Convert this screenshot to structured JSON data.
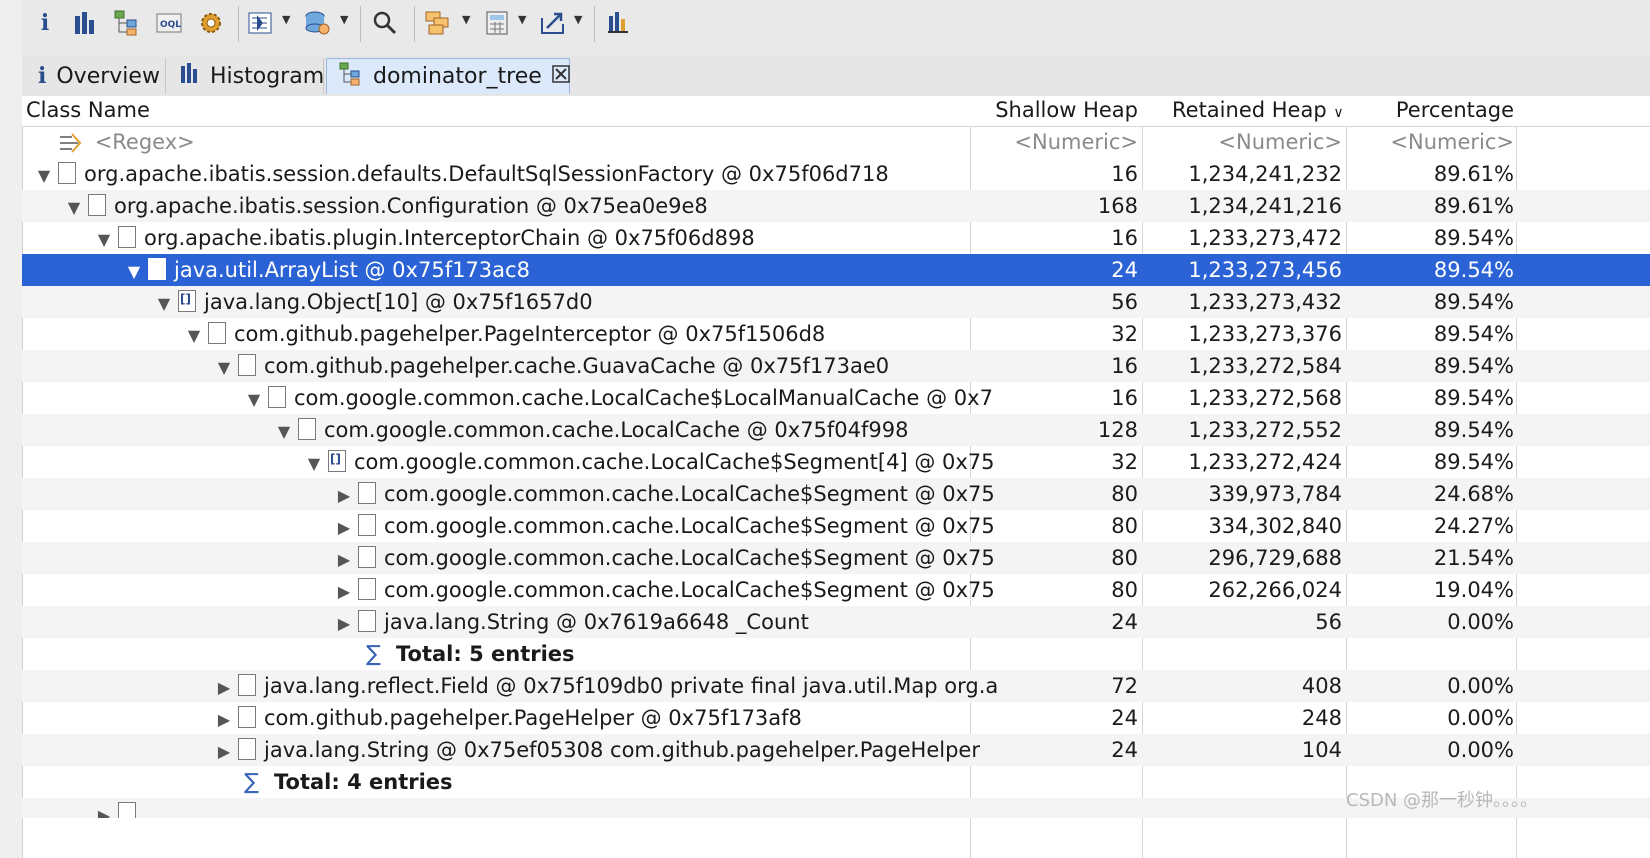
{
  "toolbar": {
    "icons": [
      "info-icon",
      "histogram-icon",
      "dominator-tree-icon",
      "oql-icon",
      "gear-icon",
      "query-browser-icon",
      "heap-dump-icon",
      "search-icon",
      "group-by-icon",
      "calculator-icon",
      "export-icon",
      "leak-suspects-icon"
    ]
  },
  "tabs": [
    {
      "label": "Overview",
      "icon": "i"
    },
    {
      "label": "Histogram",
      "icon": "▮▮"
    },
    {
      "label": "dominator_tree",
      "icon": "⊞"
    }
  ],
  "columns": {
    "name": "Class Name",
    "shallow": "Shallow Heap",
    "retained": "Retained Heap",
    "percentage": "Percentage"
  },
  "filter_row": {
    "name": "<Regex>",
    "shallow": "<Numeric>",
    "retained": "<Numeric>",
    "percentage": "<Numeric>"
  },
  "rows": [
    {
      "name": "org.apache.ibatis.session.defaults.DefaultSqlSessionFactory @ 0x75f06d718",
      "shallow": "16",
      "retained": "1,234,241,232",
      "percentage": "89.61%"
    },
    {
      "name": "org.apache.ibatis.session.Configuration @ 0x75ea0e9e8",
      "shallow": "168",
      "retained": "1,234,241,216",
      "percentage": "89.61%"
    },
    {
      "name": "org.apache.ibatis.plugin.InterceptorChain @ 0x75f06d898",
      "shallow": "16",
      "retained": "1,233,273,472",
      "percentage": "89.54%"
    },
    {
      "name": "java.util.ArrayList @ 0x75f173ac8",
      "shallow": "24",
      "retained": "1,233,273,456",
      "percentage": "89.54%"
    },
    {
      "name": "java.lang.Object[10] @ 0x75f1657d0",
      "shallow": "56",
      "retained": "1,233,273,432",
      "percentage": "89.54%"
    },
    {
      "name": "com.github.pagehelper.PageInterceptor @ 0x75f1506d8",
      "shallow": "32",
      "retained": "1,233,273,376",
      "percentage": "89.54%"
    },
    {
      "name": "com.github.pagehelper.cache.GuavaCache @ 0x75f173ae0",
      "shallow": "16",
      "retained": "1,233,272,584",
      "percentage": "89.54%"
    },
    {
      "name": "com.google.common.cache.LocalCache$LocalManualCache @ 0x7",
      "shallow": "16",
      "retained": "1,233,272,568",
      "percentage": "89.54%"
    },
    {
      "name": "com.google.common.cache.LocalCache @ 0x75f04f998",
      "shallow": "128",
      "retained": "1,233,272,552",
      "percentage": "89.54%"
    },
    {
      "name": "com.google.common.cache.LocalCache$Segment[4] @ 0x75",
      "shallow": "32",
      "retained": "1,233,272,424",
      "percentage": "89.54%"
    },
    {
      "name": "com.google.common.cache.LocalCache$Segment @ 0x75",
      "shallow": "80",
      "retained": "339,973,784",
      "percentage": "24.68%"
    },
    {
      "name": "com.google.common.cache.LocalCache$Segment @ 0x75",
      "shallow": "80",
      "retained": "334,302,840",
      "percentage": "24.27%"
    },
    {
      "name": "com.google.common.cache.LocalCache$Segment @ 0x75",
      "shallow": "80",
      "retained": "296,729,688",
      "percentage": "21.54%"
    },
    {
      "name": "com.google.common.cache.LocalCache$Segment @ 0x75",
      "shallow": "80",
      "retained": "262,266,024",
      "percentage": "19.04%"
    },
    {
      "name": "java.lang.String @ 0x7619a6648  _Count",
      "shallow": "24",
      "retained": "56",
      "percentage": "0.00%"
    },
    {
      "name": "Total: 5 entries",
      "shallow": "",
      "retained": "",
      "percentage": ""
    },
    {
      "name": "java.lang.reflect.Field @ 0x75f109db0  private final java.util.Map org.a",
      "shallow": "72",
      "retained": "408",
      "percentage": "0.00%"
    },
    {
      "name": "com.github.pagehelper.PageHelper @ 0x75f173af8",
      "shallow": "24",
      "retained": "248",
      "percentage": "0.00%"
    },
    {
      "name": "java.lang.String @ 0x75ef05308  com.github.pagehelper.PageHelper",
      "shallow": "24",
      "retained": "104",
      "percentage": "0.00%"
    },
    {
      "name": "Total: 4 entries",
      "shallow": "",
      "retained": "",
      "percentage": ""
    }
  ],
  "watermark": "CSDN @那一秒钟。。。。"
}
